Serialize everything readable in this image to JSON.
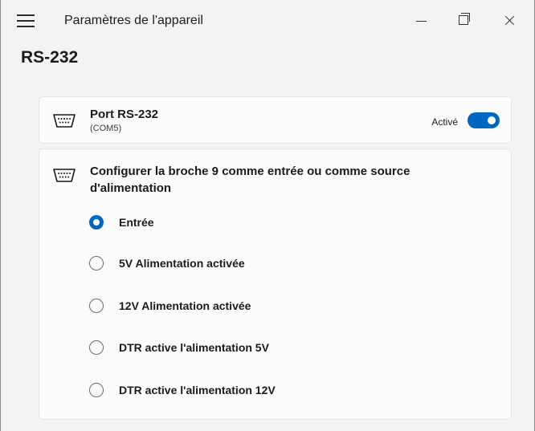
{
  "window": {
    "title": "Paramètres de l'appareil"
  },
  "page": {
    "heading": "RS-232"
  },
  "port_card": {
    "icon": "serial-port-icon",
    "title": "Port RS-232",
    "subtitle": "(COM5)",
    "toggle_label": "Activé",
    "toggle_on": true,
    "accent_color": "#0067c0"
  },
  "config_card": {
    "icon": "serial-port-icon",
    "title": "Configurer la broche 9 comme entrée ou comme source d'alimentation",
    "options": [
      {
        "label": "Entrée",
        "selected": true
      },
      {
        "label": "5V Alimentation activée",
        "selected": false
      },
      {
        "label": "12V Alimentation activée",
        "selected": false
      },
      {
        "label": "DTR active l'alimentation 5V",
        "selected": false
      },
      {
        "label": "DTR active l'alimentation 12V",
        "selected": false
      }
    ]
  }
}
